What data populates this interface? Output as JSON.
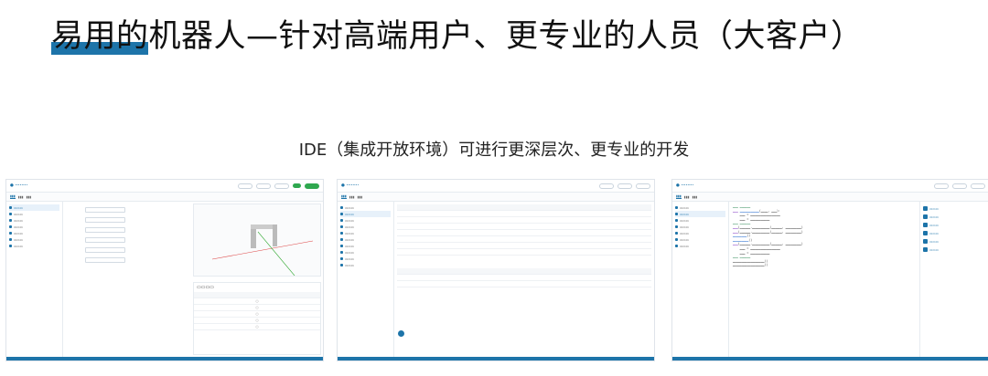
{
  "slide": {
    "title": "易用的机器人—针对高端用户、更专业的人员（大客户）",
    "subtitle": "IDE（集成开放环境）可进行更深层次、更专业的开发",
    "accent_color": "#1d74a9"
  }
}
